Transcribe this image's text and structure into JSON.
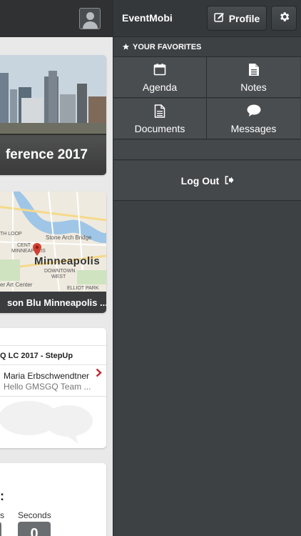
{
  "left_panel": {
    "hero": {
      "caption": "ference 2017"
    },
    "map": {
      "caption": "son Blu Minneapolis ...",
      "city_label": "Minneapolis",
      "labels": [
        "Stone Arch Bridge",
        "CENT",
        "MINNEAPOLIS",
        "TH LOOP",
        "DOWNTOWN",
        "WEST",
        "ELLIOT PARK",
        "er Art Center"
      ]
    },
    "feed": {
      "title": "Q LC 2017 - StepUp",
      "author": "Maria Erbschwendtner",
      "message": "Hello GMSGQ Team ..."
    },
    "countdown": {
      "colon": ":",
      "label_left": "s",
      "label_seconds": "Seconds",
      "seconds_value": "0"
    }
  },
  "drawer": {
    "brand": "EventMobi",
    "profile_label": "Profile",
    "favorites_heading": "YOUR FAVORITES",
    "tiles": [
      {
        "label": "Agenda",
        "icon": "calendar-icon"
      },
      {
        "label": "Notes",
        "icon": "document-icon"
      },
      {
        "label": "Documents",
        "icon": "file-icon"
      },
      {
        "label": "Messages",
        "icon": "chat-bubble-icon"
      }
    ],
    "logout_label": "Log Out"
  },
  "colors": {
    "drawer_bg": "#3e4143",
    "tile_bg": "#4a4d50",
    "accent_red": "#c0272d"
  }
}
